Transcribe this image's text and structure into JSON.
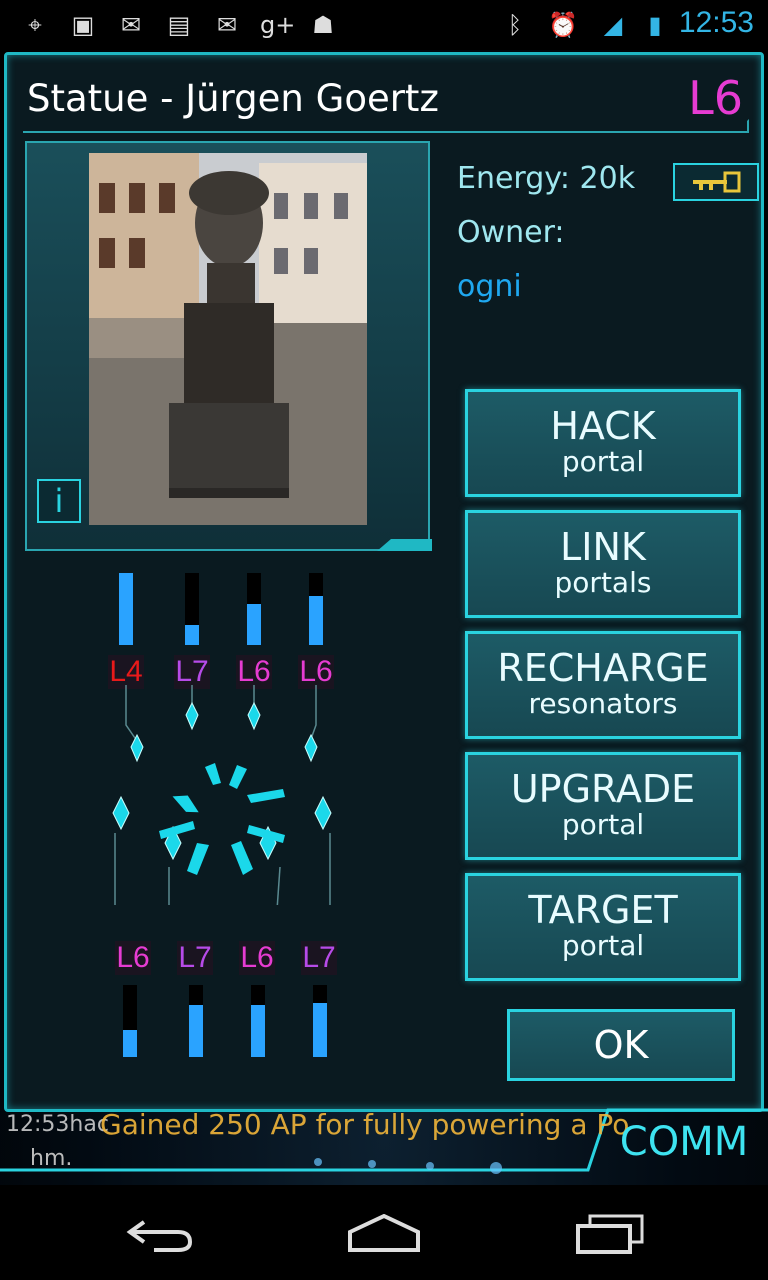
{
  "status_bar": {
    "time": "12:53",
    "icons": [
      "gps-icon",
      "image-icon",
      "gmail-icon",
      "chat-icon",
      "gmail-icon",
      "google-plus-icon",
      "android-notification-icon",
      "bluetooth-icon",
      "alarm-icon",
      "signal-icon",
      "battery-icon"
    ]
  },
  "portal": {
    "title": "Statue - Jürgen Goertz",
    "level": "L6",
    "energy_label": "Energy:",
    "energy_value": "20k",
    "owner_label": "Owner:",
    "owner_name": "ogni",
    "info_label": "i"
  },
  "actions": [
    {
      "big": "HACK",
      "small": "portal"
    },
    {
      "big": "LINK",
      "small": "portals"
    },
    {
      "big": "RECHARGE",
      "small": "resonators"
    },
    {
      "big": "UPGRADE",
      "small": "portal"
    },
    {
      "big": "TARGET",
      "small": "portal"
    }
  ],
  "ok_label": "OK",
  "resonators_top": [
    {
      "level": "L4",
      "color": "#e81a1a",
      "fill": 1.0
    },
    {
      "level": "L7",
      "color": "#b74be8",
      "fill": 0.28
    },
    {
      "level": "L6",
      "color": "#e63cd2",
      "fill": 0.57
    },
    {
      "level": "L6",
      "color": "#e63cd2",
      "fill": 0.68
    }
  ],
  "resonators_bottom": [
    {
      "level": "L6",
      "color": "#e63cd2",
      "fill": 0.37
    },
    {
      "level": "L7",
      "color": "#b74be8",
      "fill": 0.72
    },
    {
      "level": "L6",
      "color": "#e63cd2",
      "fill": 0.72
    },
    {
      "level": "L7",
      "color": "#b74be8",
      "fill": 0.75
    }
  ],
  "comm": {
    "time_text": "12:53hac",
    "message": "Gained 250 AP for fully powering a Po",
    "user": "hm.",
    "button_label": "COMM"
  },
  "colors": {
    "accent": "#2ad3e0",
    "panel_bg": "#0a1a20",
    "level_magenta": "#e63cd2",
    "owner_blue": "#1fa8f0"
  }
}
